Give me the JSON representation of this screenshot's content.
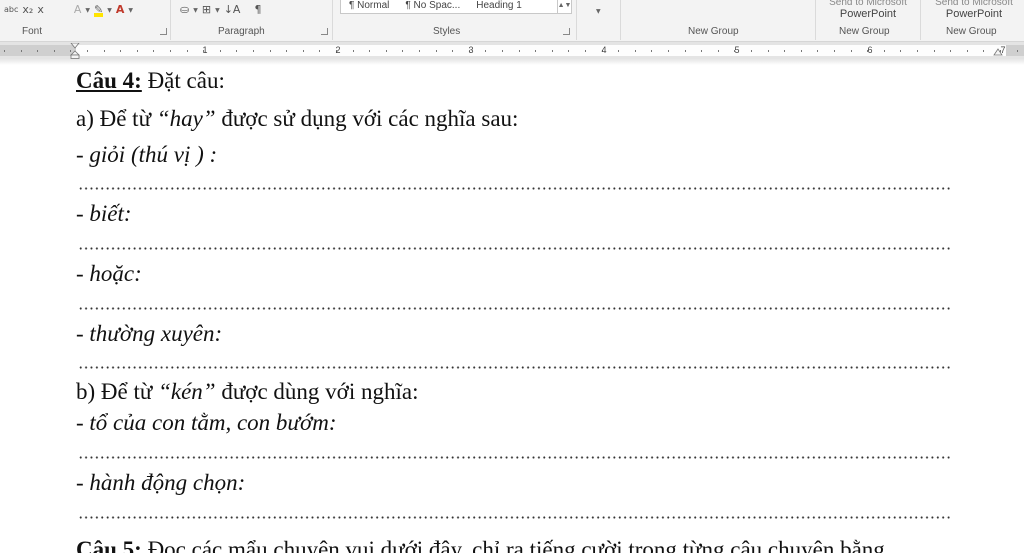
{
  "ribbon": {
    "groups": {
      "font": "Font",
      "paragraph": "Paragraph",
      "styles": "Styles",
      "new_group_1": "New Group",
      "new_group_2": "New Group",
      "new_group_3": "New Group"
    },
    "styles_gallery": [
      "¶ Normal",
      "¶ No Spac...",
      "Heading 1"
    ],
    "send_to_powerpoint_1": "PowerPoint",
    "send_to_powerpoint_2": "PowerPoint",
    "send_top_1": "Send to Microsoft",
    "send_top_2": "Send to Microsoft",
    "icons": {
      "subscript": "x₂",
      "clear": "x",
      "sort": "↓A",
      "pilcrow": "¶"
    }
  },
  "ruler": {
    "numbers": [
      "1",
      "2",
      "3",
      "4",
      "5",
      "6",
      "7"
    ]
  },
  "document": {
    "q4_label": "Câu 4:",
    "q4_title": " Đặt câu:",
    "a_pre": "a) Để từ ",
    "a_word": "“hay”",
    "a_post": " được sử dụng với các nghĩa sau:",
    "m1": "- giỏi (thú vị ) :",
    "m2": "- biết:",
    "m3": "- hoặc:",
    "m4": "- thường xuyên:",
    "b_pre": "b) Để từ ",
    "b_word": "“kén”",
    "b_post": " được dùng với nghĩa:",
    "m5": "- tổ của con tằm, con bướm:",
    "m6": "- hành động chọn:",
    "q5_label": "Câu 5:",
    "q5_text": " Đọc các mẩu chuyện vui dưới đây, chỉ ra tiếng cười trong từng câu chuyện bằng"
  }
}
